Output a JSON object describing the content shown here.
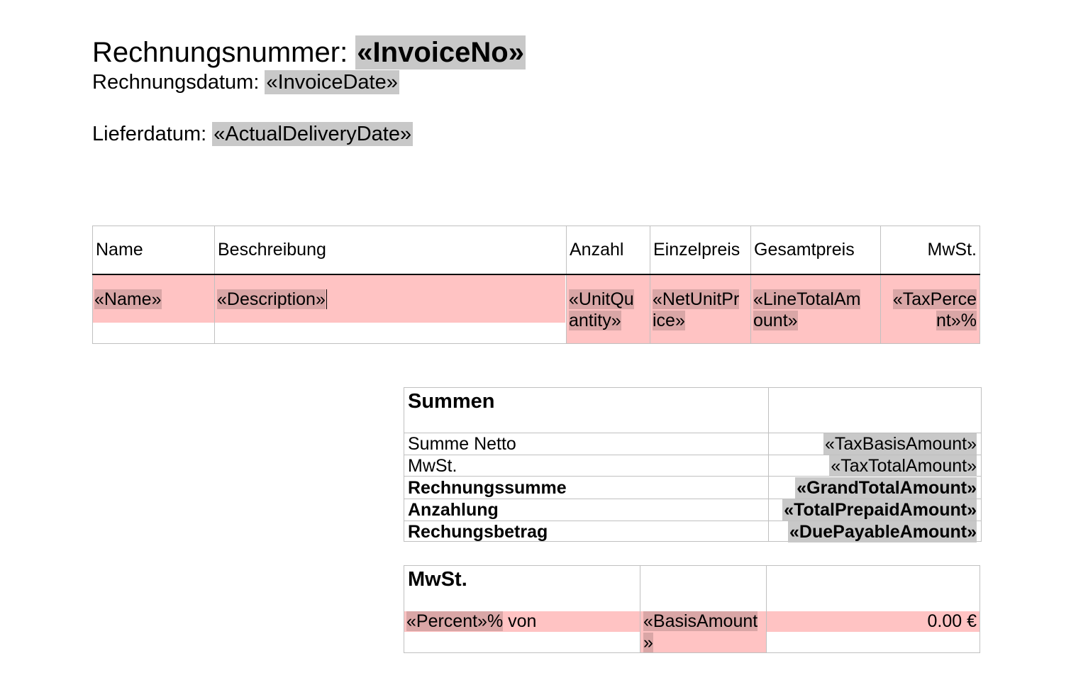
{
  "header": {
    "invoice_no_label": "Rechnungsnummer: ",
    "invoice_no_field": "«InvoiceNo»",
    "invoice_date_label": "Rechnungsdatum: ",
    "invoice_date_field": "«InvoiceDate»",
    "delivery_date_label": "Lieferdatum: ",
    "delivery_date_field": "«ActualDeliveryDate»"
  },
  "items": {
    "columns": [
      "Name",
      "Beschreibung",
      "Anzahl",
      "Einzelpreis",
      "Gesamtpreis",
      "MwSt."
    ],
    "row": {
      "name": "«Name»",
      "description": "«Description»",
      "quantity_1": "«UnitQu",
      "quantity_2": "antity»",
      "unit_price_1": "«NetUnitPr",
      "unit_price_2": "ice»",
      "line_total_1": "«LineTotalAm",
      "line_total_2": "ount»",
      "tax_1": "«TaxPerce",
      "tax_2": "nt»%"
    }
  },
  "sums": {
    "title": "Summen",
    "rows": [
      {
        "label": "Summe Netto",
        "value": "«TaxBasisAmount»"
      },
      {
        "label": "MwSt.",
        "value": "«TaxTotalAmount»"
      },
      {
        "label": "Rechnungssumme",
        "value": "«GrandTotalAmount»"
      },
      {
        "label": "Anzahlung",
        "value": "«TotalPrepaidAmount»"
      },
      {
        "label": "Rechungsbetrag",
        "value": "«DuePayableAmount»"
      }
    ]
  },
  "vat": {
    "title": "MwSt.",
    "percent_field": "«Percent»",
    "percent_sign": "%",
    "von": " von",
    "basis_1": "«BasisAmount",
    "basis_2": "»",
    "amount": "0.00 €"
  },
  "colors": {
    "field_gray": "#c8c8c8",
    "row_pink": "#ffc3c3",
    "field_pink": "#d9a6a6",
    "border": "#c0c0c0"
  }
}
